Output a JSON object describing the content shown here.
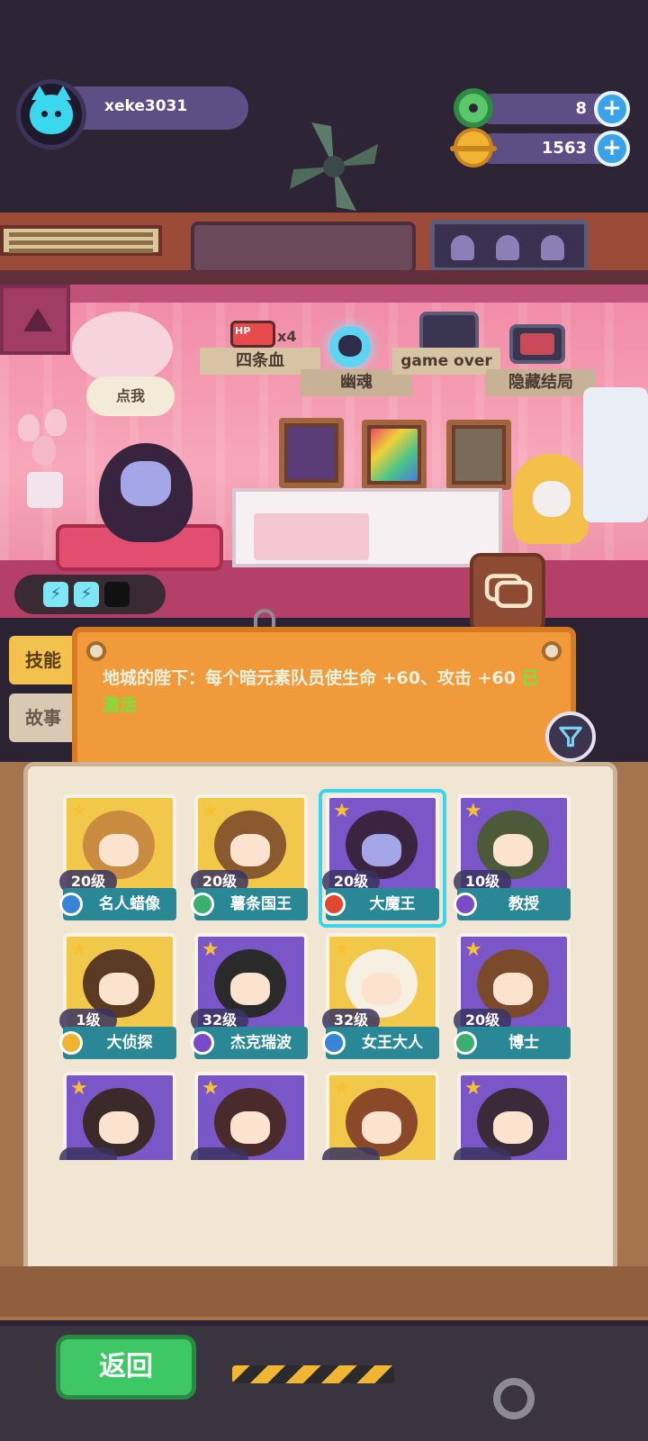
{
  "user": {
    "name": "xeke3031"
  },
  "currencies": [
    {
      "icon": "donut-icon",
      "value": "8",
      "color": "#5ac86a"
    },
    {
      "icon": "planet-coin-icon",
      "value": "1563",
      "color": "#f0b432"
    }
  ],
  "room": {
    "endings": [
      {
        "label": "四条血",
        "icon": "hp-x4-icon",
        "badge": "x4",
        "badge_prefix": "HP"
      },
      {
        "label": "幽魂",
        "icon": "ghost-skull-icon"
      },
      {
        "label": "game over",
        "icon": "tombstone-tv-icon"
      },
      {
        "label": "隐藏结局",
        "icon": "tv-hidden-icon"
      }
    ],
    "speech_bubble": "点我"
  },
  "tabs": [
    {
      "label": "技能",
      "active": true
    },
    {
      "label": "故事",
      "active": false
    }
  ],
  "info": {
    "text": "地城的陛下：每个暗元素队员使生命 +60、攻击 +60",
    "status": "已激活"
  },
  "heroes": [
    {
      "level": "20级",
      "name": "名人蜡像",
      "badge": "#3a84d8",
      "bg": "#f1c84a",
      "hair": "#c98b3f",
      "selected": false
    },
    {
      "level": "20级",
      "name": "薯条国王",
      "badge": "#3cae6d",
      "bg": "#f1c84a",
      "hair": "#8a5a2e",
      "selected": false
    },
    {
      "level": "20级",
      "name": "大魔王",
      "badge": "#e2472f",
      "bg": "#7a56c9",
      "hair": "#3a2440",
      "selected": true
    },
    {
      "level": "10级",
      "name": "教授",
      "badge": "#7a4ac8",
      "bg": "#7a56c9",
      "hair": "#4c5a3a",
      "selected": false
    },
    {
      "level": "1级",
      "name": "大侦探",
      "badge": "#f0b432",
      "bg": "#f1c84a",
      "hair": "#5a3a24",
      "selected": false
    },
    {
      "level": "32级",
      "name": "杰克瑞波",
      "badge": "#7a4ac8",
      "bg": "#7a56c9",
      "hair": "#2a2a2a",
      "selected": false
    },
    {
      "level": "32级",
      "name": "女王大人",
      "badge": "#3a84d8",
      "bg": "#f1c84a",
      "hair": "#f7efe2",
      "selected": false
    },
    {
      "level": "20级",
      "name": "博士",
      "badge": "#3cae6d",
      "bg": "#7a56c9",
      "hair": "#7a4a2a",
      "selected": false
    },
    {
      "level": "",
      "name": "",
      "badge": "#3a84d8",
      "bg": "#7a56c9",
      "hair": "#3a2a2a",
      "selected": false
    },
    {
      "level": "",
      "name": "",
      "badge": "#3a84d8",
      "bg": "#7a56c9",
      "hair": "#4a2a2a",
      "selected": false
    },
    {
      "level": "",
      "name": "",
      "badge": "#3a84d8",
      "bg": "#f1c84a",
      "hair": "#8a4a2a",
      "selected": false
    },
    {
      "level": "",
      "name": "",
      "badge": "#3a84d8",
      "bg": "#7a56c9",
      "hair": "#3a2a3a",
      "selected": false
    }
  ],
  "bottom": {
    "back_label": "返回"
  }
}
